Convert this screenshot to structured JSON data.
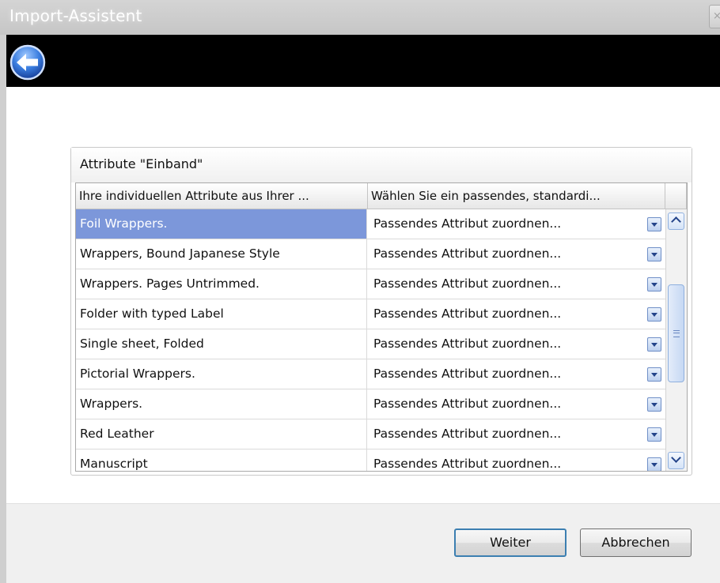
{
  "window": {
    "title": "Import-Assistent",
    "close_label": "×"
  },
  "group": {
    "title": "Attribute \"Einband\""
  },
  "grid": {
    "columns": [
      "Ihre individuellen Attribute aus Ihrer ...",
      "Wählen Sie ein passendes, standardi..."
    ],
    "rows": [
      {
        "source": "Foil Wrappers.",
        "target": "Passendes Attribut zuordnen...",
        "selected": true
      },
      {
        "source": "Wrappers, Bound Japanese Style",
        "target": "Passendes Attribut zuordnen...",
        "selected": false
      },
      {
        "source": "Wrappers. Pages Untrimmed.",
        "target": "Passendes Attribut zuordnen...",
        "selected": false
      },
      {
        "source": "Folder with typed Label",
        "target": "Passendes Attribut zuordnen...",
        "selected": false
      },
      {
        "source": "Single sheet, Folded",
        "target": "Passendes Attribut zuordnen...",
        "selected": false
      },
      {
        "source": "Pictorial Wrappers.",
        "target": "Passendes Attribut zuordnen...",
        "selected": false
      },
      {
        "source": "Wrappers.",
        "target": "Passendes Attribut zuordnen...",
        "selected": false
      },
      {
        "source": "Red Leather",
        "target": "Passendes Attribut zuordnen...",
        "selected": false
      },
      {
        "source": "Manuscript",
        "target": "Passendes Attribut zuordnen...",
        "selected": false
      }
    ]
  },
  "buttons": {
    "next": "Weiter",
    "cancel": "Abbrechen"
  },
  "icons": {
    "back": "back-arrow-icon",
    "dropdown": "chevron-down-icon",
    "scroll_up": "chevron-up-icon",
    "scroll_down": "chevron-down-icon"
  },
  "colors": {
    "selection": "#7c97da",
    "navbar": "#000000",
    "primary_border": "#3c7fb1"
  }
}
